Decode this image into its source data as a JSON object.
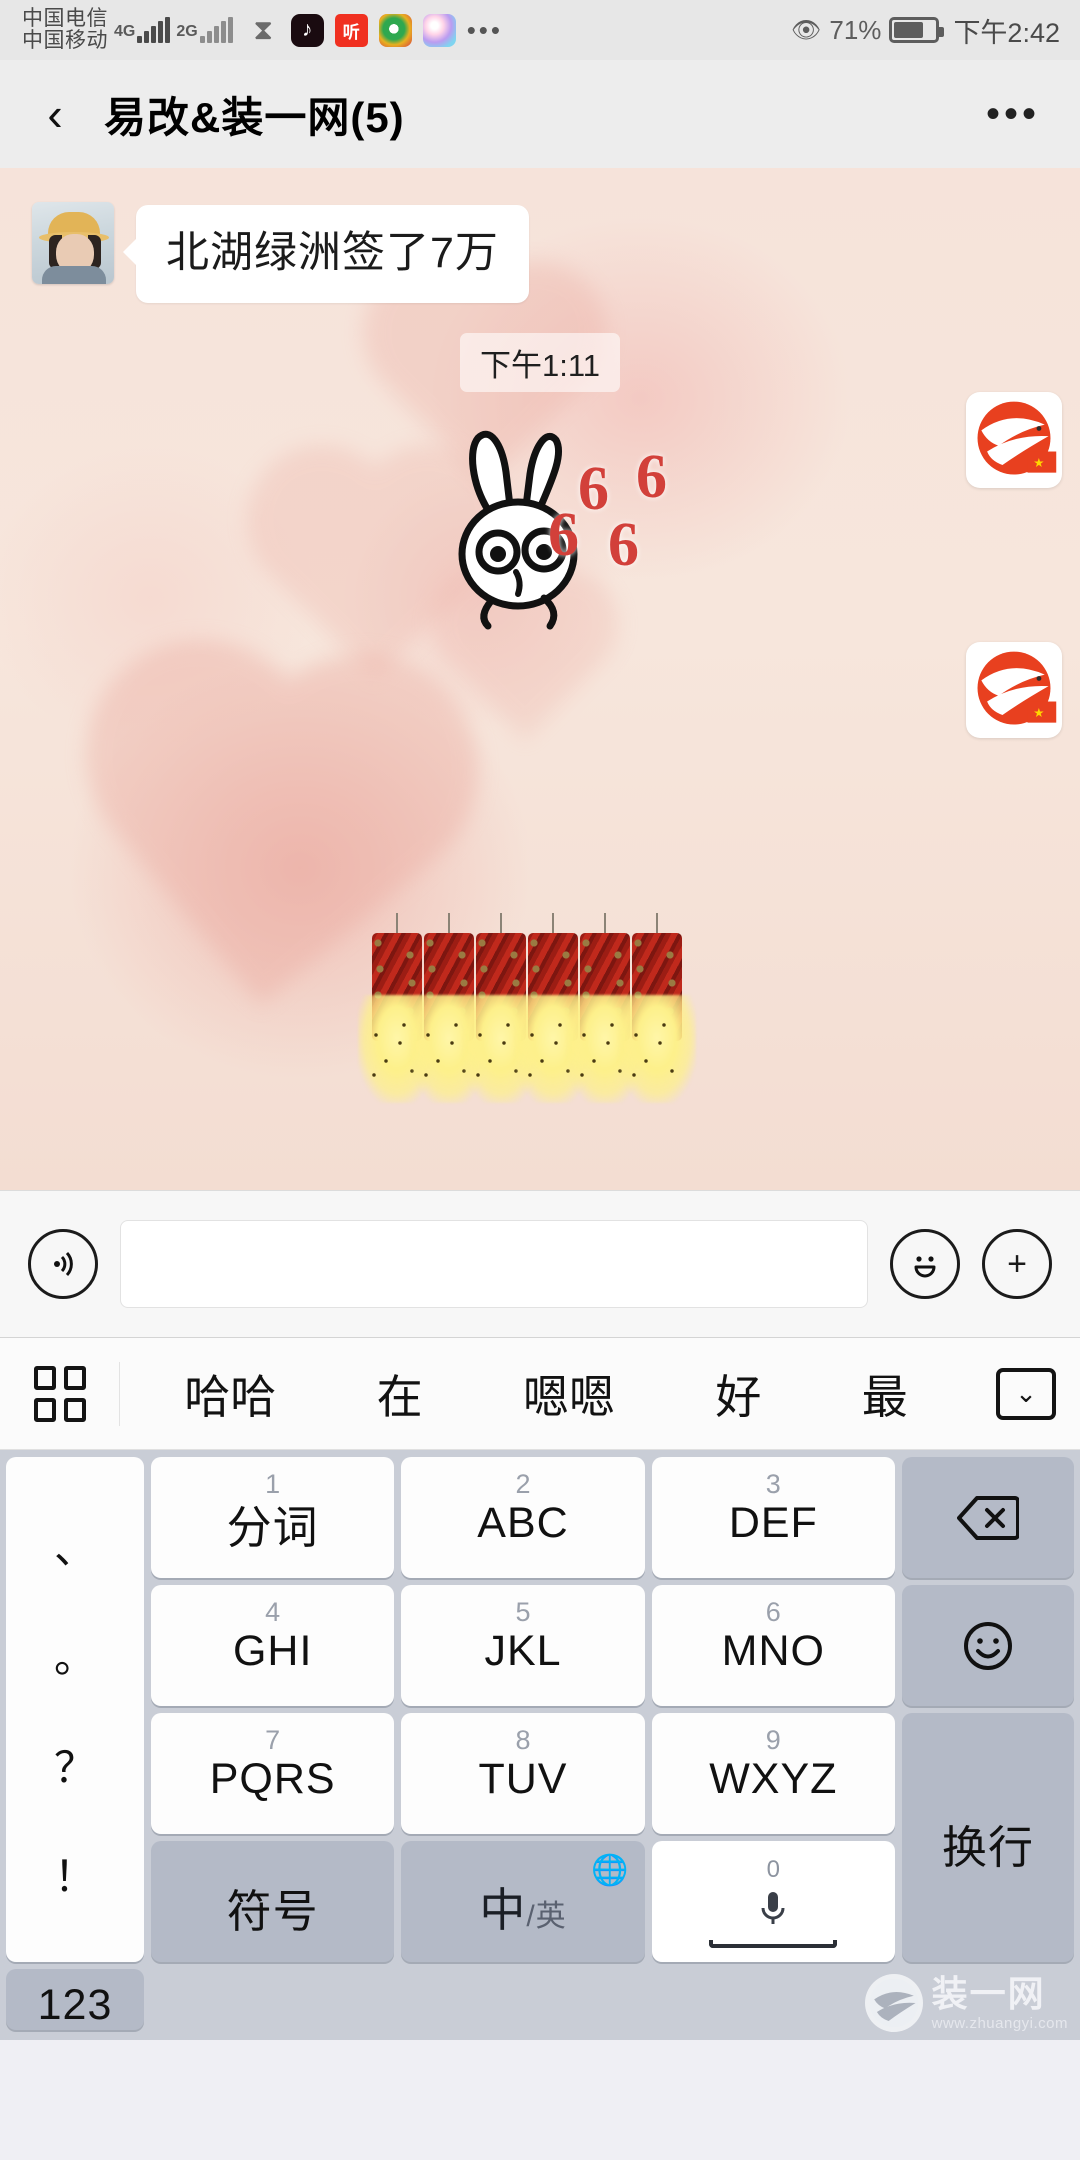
{
  "status_bar": {
    "carrier_primary": "中国电信",
    "carrier_secondary": "中国移动",
    "network_primary": "4G",
    "network_secondary": "2G",
    "tray_icons": [
      "hourglass-icon",
      "tiktok-icon",
      "ting-icon",
      "ring-icon",
      "photos-icon"
    ],
    "overflow": "•••",
    "eye_icon": "eye-care-icon",
    "battery_percent": "71%",
    "battery_level": 71,
    "time": "下午2:42"
  },
  "title_bar": {
    "back_label": "‹",
    "title": "易改&装一网(5)",
    "more_label": "•••"
  },
  "chat": {
    "messages": [
      {
        "type": "text",
        "sender_avatar": "woman-in-yellow-hat",
        "text": "北湖绿洲签了7万"
      }
    ],
    "timestamp": "下午1:11",
    "sticker_numbers": [
      "6",
      "6",
      "6",
      "6"
    ],
    "logo_count": 2,
    "firecracker_count": 6,
    "colors": {
      "bubble_bg": "#ffffff",
      "background": "#f6e3da",
      "accent_red": "#d2403a",
      "logo_red": "#e8401f"
    }
  },
  "input_bar": {
    "voice_icon": "voice-wave-icon",
    "input_value": "",
    "input_placeholder": "",
    "emoji_icon": "☺",
    "plus_icon": "+"
  },
  "candidate_bar": {
    "grid_icon": "panel-grid-icon",
    "candidates": [
      "哈哈",
      "在",
      "嗯嗯",
      "好",
      "最"
    ],
    "collapse_icon": "⌄"
  },
  "keyboard": {
    "punctuation": [
      "、",
      "。",
      "？",
      "！"
    ],
    "keys": [
      {
        "num": "1",
        "label": "分词"
      },
      {
        "num": "2",
        "label": "ABC"
      },
      {
        "num": "3",
        "label": "DEF"
      },
      {
        "num": "4",
        "label": "GHI"
      },
      {
        "num": "5",
        "label": "JKL"
      },
      {
        "num": "6",
        "label": "MNO"
      },
      {
        "num": "7",
        "label": "PQRS"
      },
      {
        "num": "8",
        "label": "TUV"
      },
      {
        "num": "9",
        "label": "WXYZ"
      }
    ],
    "backspace_icon": "⌫",
    "emoji_icon": "☺",
    "enter_label": "换行",
    "symbol_label": "符号",
    "lang_primary": "中",
    "lang_secondary": "英",
    "globe_icon": "⊕",
    "space_num": "0",
    "space_icon": "mic-icon",
    "numeric_label": "123"
  },
  "watermark": {
    "brand": "装一网",
    "url": "www.zhuangyi.com"
  }
}
